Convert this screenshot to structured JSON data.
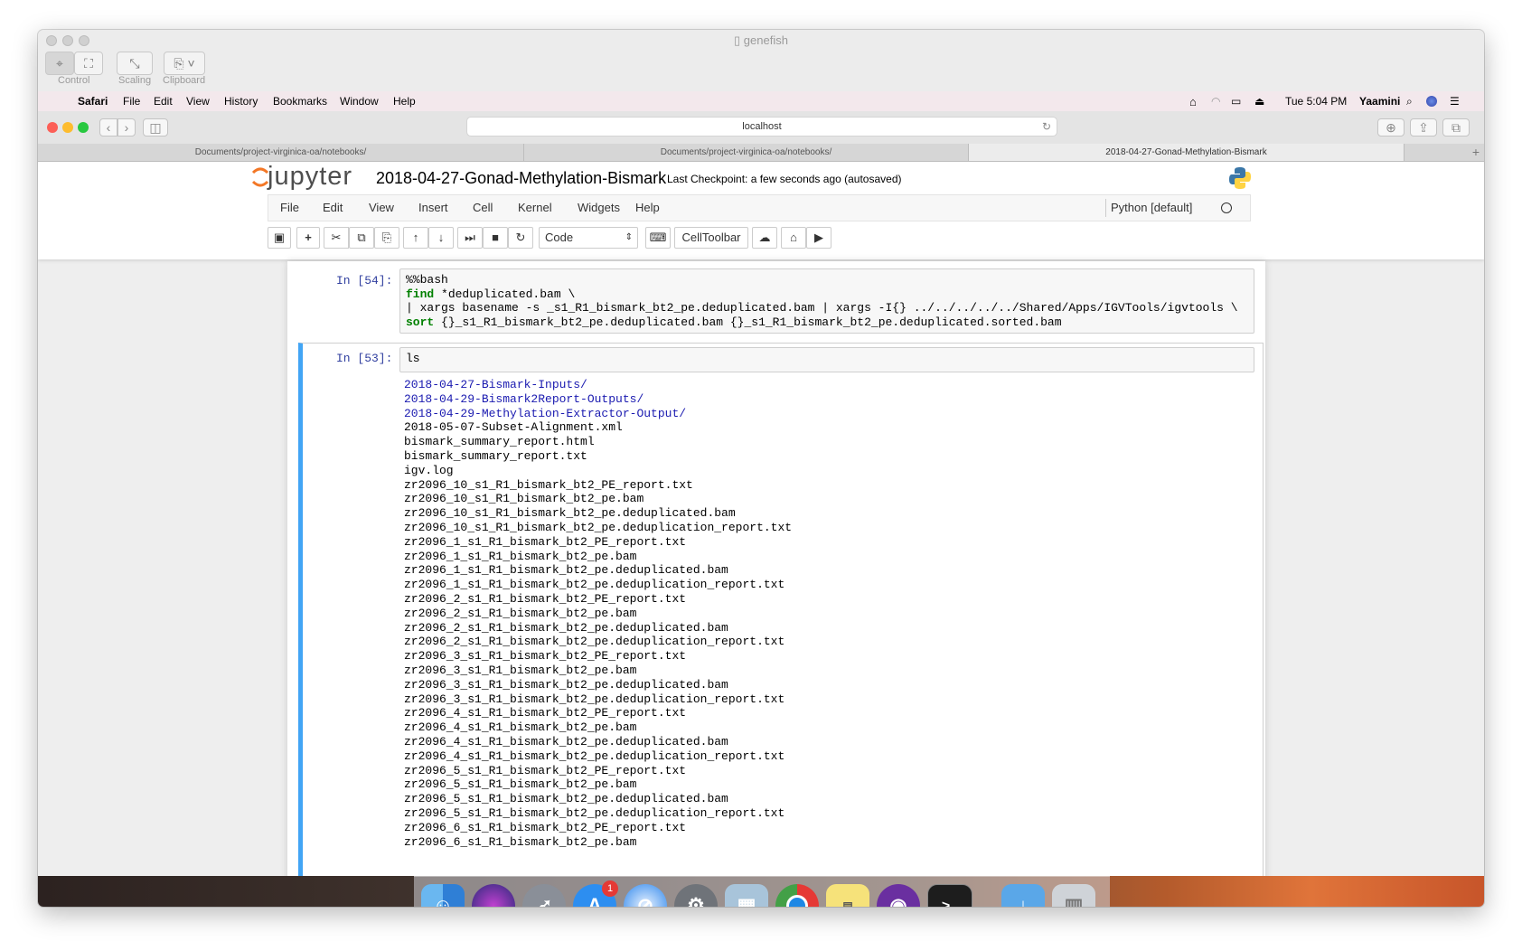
{
  "vnc_window": {
    "title": "genefish",
    "toolbar": [
      {
        "label": "Control",
        "icon": "pointer-icon"
      },
      {
        "label": "Scaling",
        "icon": "scaling-icon"
      },
      {
        "label": "Clipboard",
        "icon": "clipboard-icon"
      }
    ]
  },
  "mac_menubar": {
    "app": "Safari",
    "items": [
      "File",
      "Edit",
      "View",
      "History",
      "Bookmarks",
      "Window",
      "Help"
    ],
    "clock": "Tue 5:04 PM",
    "user": "Yaamini"
  },
  "safari": {
    "url": "localhost",
    "tabs": [
      "Documents/project-virginica-oa/notebooks/",
      "Documents/project-virginica-oa/notebooks/",
      "2018-04-27-Gonad-Methylation-Bismark"
    ]
  },
  "jupyter": {
    "logo_text": "jupyter",
    "notebook_name": "2018-04-27-Gonad-Methylation-Bismark",
    "checkpoint": "Last Checkpoint: a few seconds ago (autosaved)",
    "menu": [
      "File",
      "Edit",
      "View",
      "Insert",
      "Cell",
      "Kernel",
      "Widgets",
      "Help"
    ],
    "kernel": "Python [default]",
    "cell_type": "Code",
    "celltoolbar": "CellToolbar"
  },
  "cells": [
    {
      "prompt": "In [54]:",
      "lines": {
        "l1": "%%bash",
        "l2_kw": "find",
        "l2_rest": " *deduplicated.bam \\",
        "l3": "| xargs basename -s _s1_R1_bismark_bt2_pe.deduplicated.bam | xargs -I{} ../../../../../Shared/Apps/IGVTools/igvtools \\",
        "l4_kw": "sort",
        "l4_rest": " {}_s1_R1_bismark_bt2_pe.deduplicated.bam {}_s1_R1_bismark_bt2_pe.deduplicated.sorted.bam"
      }
    },
    {
      "prompt": "In [53]:",
      "input": "ls",
      "output": [
        "2018-04-27-Bismark-Inputs/",
        "2018-04-29-Bismark2Report-Outputs/",
        "2018-04-29-Methylation-Extractor-Output/",
        "2018-05-07-Subset-Alignment.xml",
        "bismark_summary_report.html",
        "bismark_summary_report.txt",
        "igv.log",
        "zr2096_10_s1_R1_bismark_bt2_PE_report.txt",
        "zr2096_10_s1_R1_bismark_bt2_pe.bam",
        "zr2096_10_s1_R1_bismark_bt2_pe.deduplicated.bam",
        "zr2096_10_s1_R1_bismark_bt2_pe.deduplication_report.txt",
        "zr2096_1_s1_R1_bismark_bt2_PE_report.txt",
        "zr2096_1_s1_R1_bismark_bt2_pe.bam",
        "zr2096_1_s1_R1_bismark_bt2_pe.deduplicated.bam",
        "zr2096_1_s1_R1_bismark_bt2_pe.deduplication_report.txt",
        "zr2096_2_s1_R1_bismark_bt2_PE_report.txt",
        "zr2096_2_s1_R1_bismark_bt2_pe.bam",
        "zr2096_2_s1_R1_bismark_bt2_pe.deduplicated.bam",
        "zr2096_2_s1_R1_bismark_bt2_pe.deduplication_report.txt",
        "zr2096_3_s1_R1_bismark_bt2_PE_report.txt",
        "zr2096_3_s1_R1_bismark_bt2_pe.bam",
        "zr2096_3_s1_R1_bismark_bt2_pe.deduplicated.bam",
        "zr2096_3_s1_R1_bismark_bt2_pe.deduplication_report.txt",
        "zr2096_4_s1_R1_bismark_bt2_PE_report.txt",
        "zr2096_4_s1_R1_bismark_bt2_pe.bam",
        "zr2096_4_s1_R1_bismark_bt2_pe.deduplicated.bam",
        "zr2096_4_s1_R1_bismark_bt2_pe.deduplication_report.txt",
        "zr2096_5_s1_R1_bismark_bt2_PE_report.txt",
        "zr2096_5_s1_R1_bismark_bt2_pe.bam",
        "zr2096_5_s1_R1_bismark_bt2_pe.deduplicated.bam",
        "zr2096_5_s1_R1_bismark_bt2_pe.deduplication_report.txt",
        "zr2096_6_s1_R1_bismark_bt2_PE_report.txt",
        "zr2096_6_s1_R1_bismark_bt2_pe.bam"
      ]
    }
  ],
  "dock": {
    "badge": "1",
    "apps": [
      "finder-icon",
      "siri-icon",
      "launchpad-icon",
      "app-store-icon",
      "safari-icon",
      "system-preferences-icon",
      "preview-icon",
      "chrome-icon",
      "stickies-icon",
      "github-icon",
      "terminal-icon",
      "downloads-folder-icon",
      "trash-icon"
    ]
  },
  "colors": {
    "menubar_bg": "#f3e8ec",
    "jupyter_orange": "#f37726",
    "prompt_blue": "#303f9f",
    "selected_cell": "#42a5f5",
    "dir_blue": "#1a1ab0"
  }
}
